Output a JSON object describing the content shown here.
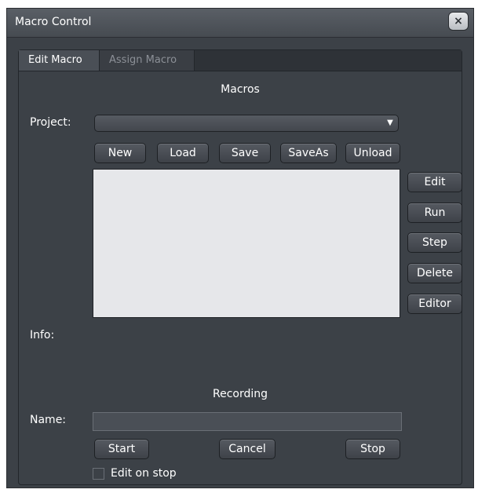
{
  "window": {
    "title": "Macro Control",
    "close_glyph": "×"
  },
  "tabs": [
    {
      "label": "Edit Macro",
      "active": true
    },
    {
      "label": "Assign Macro",
      "active": false
    }
  ],
  "macros": {
    "section_title": "Macros",
    "project_label": "Project:",
    "project_value": "",
    "buttons": {
      "new": "New",
      "load": "Load",
      "save": "Save",
      "saveas": "SaveAs",
      "unload": "Unload"
    },
    "side_buttons": {
      "edit": "Edit",
      "run": "Run",
      "step": "Step",
      "delete": "Delete",
      "editor": "Editor"
    },
    "info_label": "Info:"
  },
  "recording": {
    "section_title": "Recording",
    "name_label": "Name:",
    "name_value": "",
    "buttons": {
      "start": "Start",
      "cancel": "Cancel",
      "stop": "Stop"
    },
    "edit_on_stop_label": "Edit on stop",
    "edit_on_stop_checked": false
  },
  "icons": {
    "dropdown": "chevron-down-icon",
    "close": "close-icon"
  },
  "colors": {
    "window_bg": "#3c4147",
    "listbox_bg": "#e6e7ea",
    "tab_inactive_text": "#8c9097"
  }
}
